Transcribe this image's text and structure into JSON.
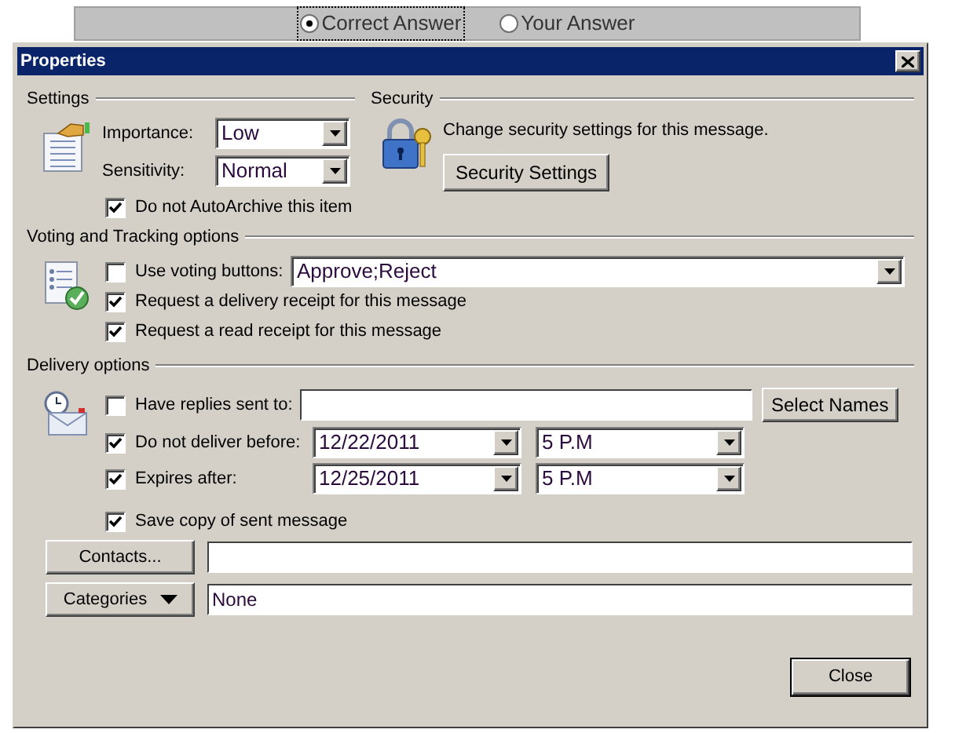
{
  "answer_toggle": [
    {
      "label": "Correct Answer",
      "selected": true
    },
    {
      "label": "Your Answer",
      "selected": false
    }
  ],
  "window": {
    "title": "Properties"
  },
  "settings": {
    "heading": "Settings",
    "importance": {
      "label": "Importance:",
      "value": "Low"
    },
    "sensitivity": {
      "label": "Sensitivity:",
      "value": "Normal"
    },
    "autoarchive": {
      "label": "Do not AutoArchive this item",
      "checked": true
    }
  },
  "security": {
    "heading": "Security",
    "description": "Change security settings for this message.",
    "button": "Security Settings"
  },
  "voting": {
    "heading": "Voting and Tracking options",
    "use_voting": {
      "label": "Use voting buttons:",
      "checked": false,
      "value": "Approve;Reject"
    },
    "receipts": [
      {
        "label": "Request a delivery receipt for this message",
        "checked": true
      },
      {
        "label": "Request a read receipt for this message",
        "checked": true
      }
    ]
  },
  "delivery": {
    "heading": "Delivery options",
    "replies": {
      "label": "Have replies sent to:",
      "checked": false
    },
    "select_names": "Select Names",
    "schedule": [
      {
        "label": "Do not deliver before:",
        "checked": true,
        "date": "12/22/2011",
        "time": "5 P.M"
      },
      {
        "label": "Expires after:",
        "checked": true,
        "date": "12/25/2011",
        "time": "5 P.M"
      }
    ],
    "save_copy": {
      "label": "Save copy of sent message",
      "checked": true
    }
  },
  "contacts": {
    "button": "Contacts..."
  },
  "categories": {
    "button": "Categories",
    "value": "None"
  },
  "buttons": [
    "Close"
  ]
}
